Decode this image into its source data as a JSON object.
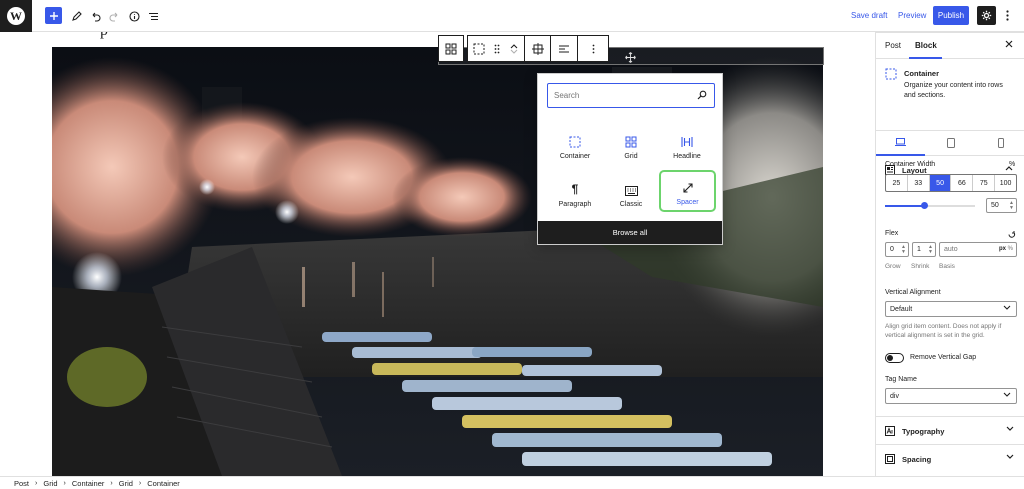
{
  "topbar": {
    "wp_logo_letter": "W",
    "save_draft": "Save draft",
    "preview": "Preview",
    "publish": "Publish"
  },
  "canvas": {
    "title_fragment": "p"
  },
  "inserter": {
    "search_placeholder": "Search",
    "blocks": [
      {
        "label": "Container",
        "icon": "container-icon"
      },
      {
        "label": "Grid",
        "icon": "grid-icon"
      },
      {
        "label": "Headline",
        "icon": "headline-icon"
      },
      {
        "label": "Paragraph",
        "icon": "paragraph-icon"
      },
      {
        "label": "Classic",
        "icon": "classic-icon"
      },
      {
        "label": "Spacer",
        "icon": "spacer-icon",
        "highlighted": true
      }
    ],
    "browse_all": "Browse all"
  },
  "sidebar": {
    "tab_post": "Post",
    "tab_block": "Block",
    "block_name": "Container",
    "block_description": "Organize your content into rows and sections.",
    "layout_title": "Layout",
    "container_width_label": "Container Width",
    "container_width_unit": "%",
    "width_options": [
      "25",
      "33",
      "50",
      "66",
      "75",
      "100"
    ],
    "width_selected": "50",
    "width_value": "50",
    "flex_label": "Flex",
    "flex_grow": "0",
    "flex_shrink": "1",
    "flex_basis_placeholder": "auto",
    "flex_basis_unit": "px",
    "grow_label": "Grow",
    "shrink_label": "Shrink",
    "basis_label": "Basis",
    "vertical_alignment_label": "Vertical Alignment",
    "vertical_alignment_value": "Default",
    "vertical_alignment_help": "Align grid item content. Does not apply if vertical alignment is set in the grid.",
    "remove_vertical_gap_label": "Remove Vertical Gap",
    "tag_name_label": "Tag Name",
    "tag_name_value": "div",
    "typography_title": "Typography",
    "spacing_title": "Spacing"
  },
  "breadcrumb": [
    "Post",
    "Grid",
    "Container",
    "Grid",
    "Container"
  ],
  "colors": {
    "accent": "#3858e9",
    "dark": "#1e1e1e",
    "highlight_ring": "#6cd46c"
  }
}
